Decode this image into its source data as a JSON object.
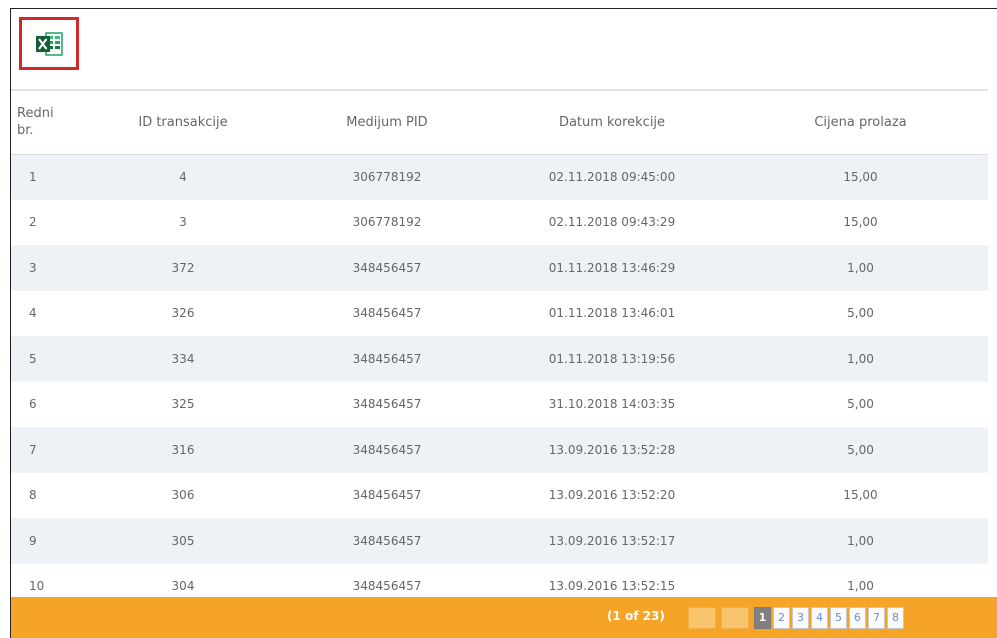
{
  "toolbar": {
    "export_icon": "excel-export-icon",
    "export_highlight_color": "#d0282d"
  },
  "table": {
    "headers": [
      "Redni\nbr.",
      "ID transakcije",
      "Medijum PID",
      "Datum korekcije",
      "Cijena prolaza"
    ],
    "rows": [
      [
        "1",
        "4",
        "306778192",
        "02.11.2018 09:45:00",
        "15,00"
      ],
      [
        "2",
        "3",
        "306778192",
        "02.11.2018 09:43:29",
        "15,00"
      ],
      [
        "3",
        "372",
        "348456457",
        "01.11.2018 13:46:29",
        "1,00"
      ],
      [
        "4",
        "326",
        "348456457",
        "01.11.2018 13:46:01",
        "5,00"
      ],
      [
        "5",
        "334",
        "348456457",
        "01.11.2018 13:19:56",
        "1,00"
      ],
      [
        "6",
        "325",
        "348456457",
        "31.10.2018 14:03:35",
        "5,00"
      ],
      [
        "7",
        "316",
        "348456457",
        "13.09.2016 13:52:28",
        "5,00"
      ],
      [
        "8",
        "306",
        "348456457",
        "13.09.2016 13:52:20",
        "15,00"
      ],
      [
        "9",
        "305",
        "348456457",
        "13.09.2016 13:52:17",
        "1,00"
      ],
      [
        "10",
        "304",
        "348456457",
        "13.09.2016 13:52:15",
        "1,00"
      ]
    ]
  },
  "pager": {
    "info": "(1 of 23)",
    "prev_icons": [
      "first-page-icon",
      "prev-page-icon"
    ],
    "pages": [
      "1",
      "2",
      "3",
      "4",
      "5",
      "6",
      "7",
      "8"
    ],
    "active_page": "1",
    "bar_color": "#f5a428"
  }
}
